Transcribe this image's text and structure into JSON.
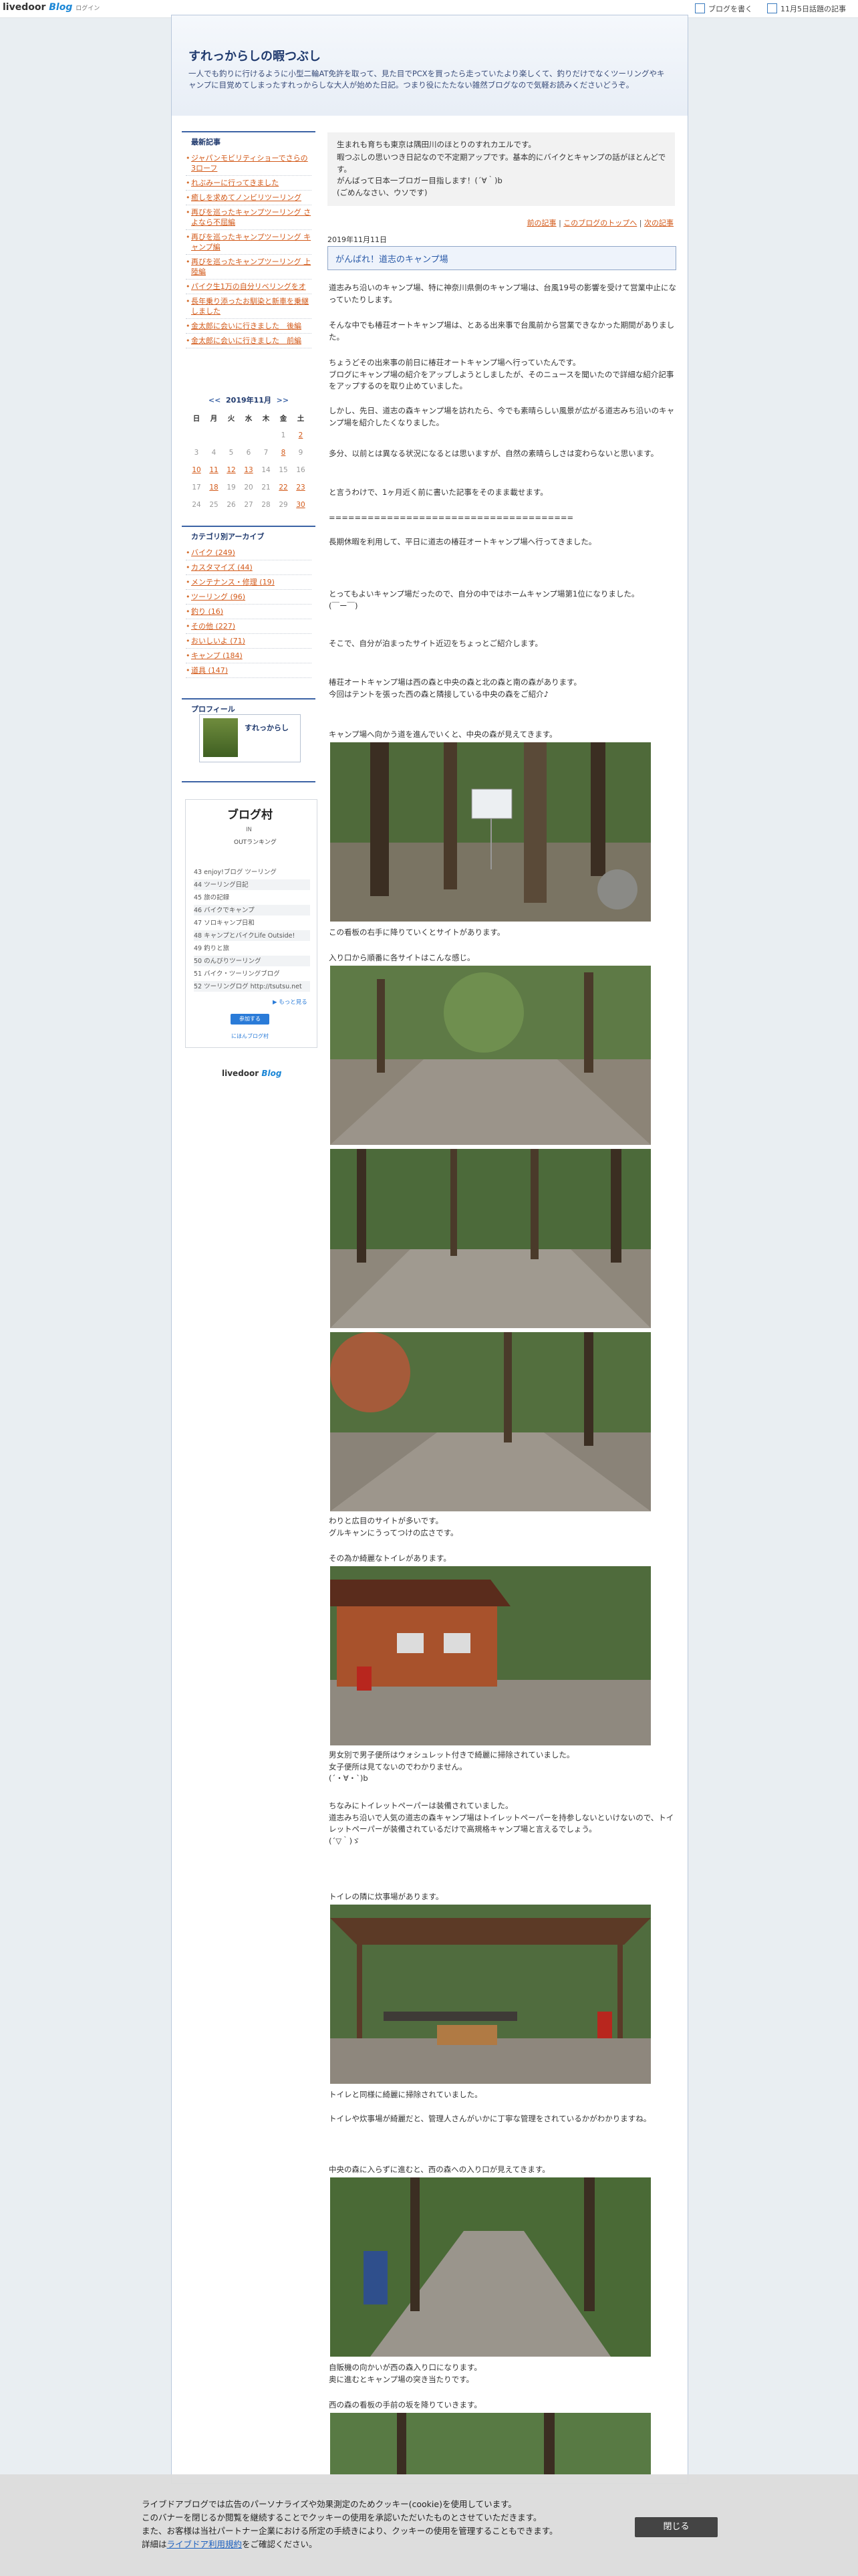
{
  "topbar": {
    "logo_main": "livedoor",
    "logo_blog": "Blog",
    "logo_sub": "ログイン",
    "write_label": "ブログを書く",
    "today_label": "11月5日話題の記事"
  },
  "blog": {
    "title": "すれっからしの暇つぶし",
    "description": "一人でも釣りに行けるように小型二輪AT免許を取って、見た目でPCXを買ったら走っていたより楽しくて、釣りだけでなくツーリングやキャンプに目覚めてしまったすれっからしな大人が始めた日記。つまり役にたたない雑然ブログなので気軽お読みくださいどうぞ。"
  },
  "sidebar": {
    "recent_title": "最新記事",
    "recent": [
      "ジャパンモビリティショーでさらの3ローフ",
      "れぶみーに行ってきました",
      "癒しを求めてノンビリツーリング",
      "再びを巡ったキャンプツーリング さよなら不屈編",
      "再びを巡ったキャンプツーリング キャンプ編",
      "再びを巡ったキャンプツーリング 上陸編",
      "パイク生1万の自分リベリングをオ",
      "長年乗り添ったお馴染と新車を乗継しました",
      "金太郎に会いに行きました　後編",
      "金太郎に会いに行きました　前編"
    ],
    "calendar": {
      "prev": "<<",
      "label": "2019年11月",
      "next": ">>",
      "weekdays": [
        "日",
        "月",
        "火",
        "水",
        "木",
        "金",
        "土"
      ],
      "rows": [
        [
          "",
          "",
          "",
          "",
          "",
          "1",
          "2"
        ],
        [
          "3",
          "4",
          "5",
          "6",
          "7",
          "8",
          "9"
        ],
        [
          "10",
          "11",
          "12",
          "13",
          "14",
          "15",
          "16"
        ],
        [
          "17",
          "18",
          "19",
          "20",
          "21",
          "22",
          "23"
        ],
        [
          "24",
          "25",
          "26",
          "27",
          "28",
          "29",
          "30"
        ]
      ],
      "linked": [
        "2",
        "8",
        "10",
        "11",
        "12",
        "13",
        "18",
        "22",
        "23",
        "30"
      ]
    },
    "category_title": "カテゴリ別アーカイブ",
    "categories": [
      "バイク (249)",
      "カスタマイズ (44)",
      "メンテナンス・修理 (19)",
      "ツーリング (96)",
      "釣り (16)",
      "その他 (227)",
      "おいしいよ (71)",
      "キャンプ (184)",
      "道具 (147)"
    ],
    "profile_title": "プロフィール",
    "profile_name": "すれっからし",
    "village": {
      "logo": "ブログ村",
      "in_label": "IN",
      "out_label": "OUTランキング",
      "rows": [
        "43 enjoy!ブログ ツーリング",
        "44 ツーリング日記",
        "45 旅の記録",
        "46 バイクでキャンプ",
        "47 ソロキャンプ日和",
        "48 キャンプとバイクLife Outside!",
        "49 釣りと旅",
        "50 のんびりツーリング",
        "51 バイク・ツーリングブログ",
        "52 ツーリングログ http://tsutsu.net"
      ],
      "more": "▶ もっと見る",
      "button": "参加する",
      "footer": "にほんブログ村"
    },
    "footer_logo_main": "livedoor",
    "footer_logo_blog": "Blog"
  },
  "main": {
    "intro": [
      "生まれも育ちも東京は隅田川のほとりのすれカエルです。",
      "暇つぶしの思いつき日記なので不定期アップです。基本的にバイクとキャンプの話がほとんどです。",
      "がんばって日本一ブロガー目指します！(´∀｀)b",
      "(ごめんなさい、ウソです)"
    ],
    "nav": {
      "prev": "前の記事",
      "sep1": "|",
      "top": "このブログのトップへ",
      "sep2": "|",
      "next": "次の記事"
    },
    "date": "2019年11月11日",
    "post_title": "がんばれ！道志のキャンプ場",
    "paragraphs": [
      "道志みち沿いのキャンプ場、特に神奈川県側のキャンプ場は、台風19号の影響を受けて営業中止になっていたりします。",
      "そんな中でも椿荘オートキャンプ場は、とある出来事で台風前から営業できなかった期間がありました。",
      "ちょうどその出来事の前日に椿荘オートキャンプ場へ行っていたんです。\nブログにキャンプ場の紹介をアップしようとしましたが、そのニュースを聞いたので詳細な紹介記事をアップするのを取り止めていました。",
      "しかし、先日、道志の森キャンプ場を訪れたら、今でも素晴らしい風景が広がる道志みち沿いのキャンプ場を紹介したくなりました。",
      "多分、以前とは異なる状況になるとは思いますが、自然の素晴らしさは変わらないと思います。",
      "と言うわけで、1ヶ月近く前に書いた記事をそのまま載せます。",
      "======================================",
      "長期休暇を利用して、平日に道志の椿荘オートキャンプ場へ行ってきました。",
      "とってもよいキャンプ場だったので、自分の中ではホームキャンプ場第1位になりました。\n(￣ー￣)",
      "そこで、自分が泊まったサイト近辺をちょっとご紹介します。",
      "椿荘オートキャンプ場は西の森と中央の森と北の森と南の森があります。\n今回はテントを張った西の森と隣接している中央の森をご紹介♪",
      "キャンプ場へ向かう道を進んでいくと、中央の森が見えてきます。",
      "この看板の右手に降りていくとサイトがあります。",
      "入り口から順番に各サイトはこんな感じ。",
      "わりと広目のサイトが多いです。\nグルキャンにうってつけの広さです。",
      "その為か綺麗なトイレがあります。",
      "男女別で男子便所はウォシュレット付きで綺麗に掃除されていました。\n女子便所は見てないのでわかりません。\n(´・∀・`)b",
      "ちなみにトイレットペーパーは装備されていました。\n道志みち沿いで人気の道志の森キャンプ場はトイレットペーパーを持参しないといけないので、トイレットペーパーが装備されているだけで高規格キャンプ場と言えるでしょう。\n(´▽｀)ゞ",
      "トイレの隣に炊事場があります。",
      "トイレと同様に綺麗に掃除されていました。",
      "トイレや炊事場が綺麗だと、管理人さんがいかに丁寧な管理をされているかがわかりますね。",
      "中央の森に入らずに進むと、西の森への入り口が見えてきます。",
      "自販機の向かいが西の森入り口になります。\n奥に進むとキャンプ場の突き当たりです。",
      "西の森の看板の手前の坂を降りていきます。"
    ]
  },
  "cookie": {
    "line1": "ライブドアブログでは広告のパーソナライズや効果測定のためクッキー(cookie)を使用しています。",
    "line2": "このバナーを閉じるか閲覧を継続することでクッキーの使用を承認いただいたものとさせていただきます。",
    "line3": "また、お客様は当社パートナー企業における所定の手続きにより、クッキーの使用を管理することもできます。",
    "line4_pre": "詳細は",
    "line4_link": "ライブドア利用規約",
    "line4_post": "をご確認ください。",
    "close": "閉じる"
  },
  "colors": {
    "accent": "#3c63a5",
    "link": "#d35a1a",
    "title": "#203a6e"
  }
}
